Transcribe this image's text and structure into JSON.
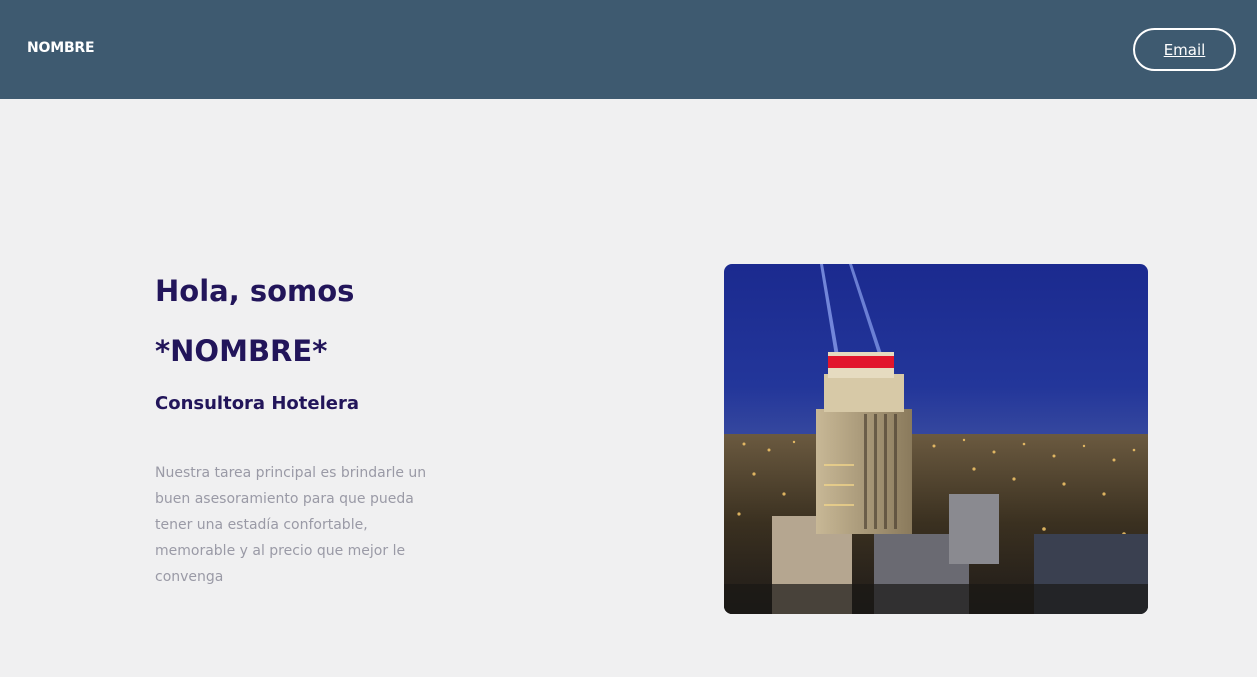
{
  "header": {
    "brand": "NOMBRE",
    "email_label": "Email"
  },
  "hero": {
    "headline_line1": "Hola, somos",
    "headline_line2": "*NOMBRE*",
    "subtitle": "Consultora Hotelera",
    "description": "Nuestra tarea principal es brindarle un buen asesoramiento para que pueda tener una estadía confortable, memorable y al precio que mejor le convenga"
  },
  "colors": {
    "header_bg": "#3e5a70",
    "page_bg": "#f0f0f1",
    "heading": "#22155a",
    "body_text": "#9a9aa6"
  }
}
